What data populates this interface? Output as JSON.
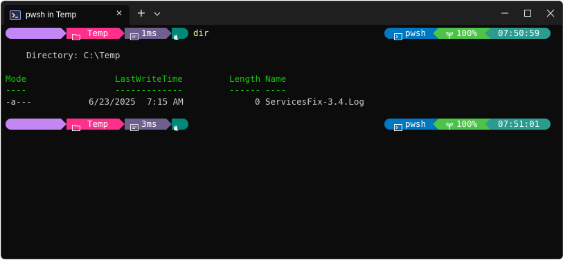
{
  "window": {
    "tab_title": "pwsh in Temp",
    "tab_close_glyph": "✕",
    "new_tab_glyph": "+"
  },
  "prompts": [
    {
      "folder": "Temp",
      "duration": "1ms",
      "command": "dir",
      "shell": "pwsh",
      "battery": "100%",
      "time": "07:50:59"
    },
    {
      "folder": "Temp",
      "duration": "3ms",
      "command": "",
      "shell": "pwsh",
      "battery": "100%",
      "time": "07:51:01"
    }
  ],
  "output": {
    "directory_line": "Directory: C:\\Temp",
    "headers": {
      "mode": "Mode",
      "lastwritetime": "LastWriteTime",
      "length": "Length",
      "name": "Name"
    },
    "underlines": {
      "mode": "----",
      "lastwritetime": "-------------",
      "length": "------",
      "name": "----"
    },
    "rows": [
      {
        "mode": "-a---",
        "date": "6/23/2025",
        "time": "7:15 AM",
        "length": "0",
        "name": "ServicesFix-3.4.Log"
      }
    ]
  },
  "icons": {
    "tab": "powershell-icon",
    "folder": "folder-icon",
    "duration": "timer-icon",
    "hand": "hand-icon",
    "shell": "terminal-icon",
    "battery": "leaf-icon"
  },
  "colors": {
    "background": "#0c0c0c",
    "prompt_os": "#c287f4",
    "prompt_path": "#ff2f8c",
    "prompt_duration": "#6f5f8f",
    "prompt_status": "#00897b",
    "prompt_shell": "#0077c2",
    "prompt_battery": "#4ec34a",
    "prompt_time": "#2a9d90",
    "header_green": "#16c60c",
    "command_yellow": "#f9f1a5"
  }
}
